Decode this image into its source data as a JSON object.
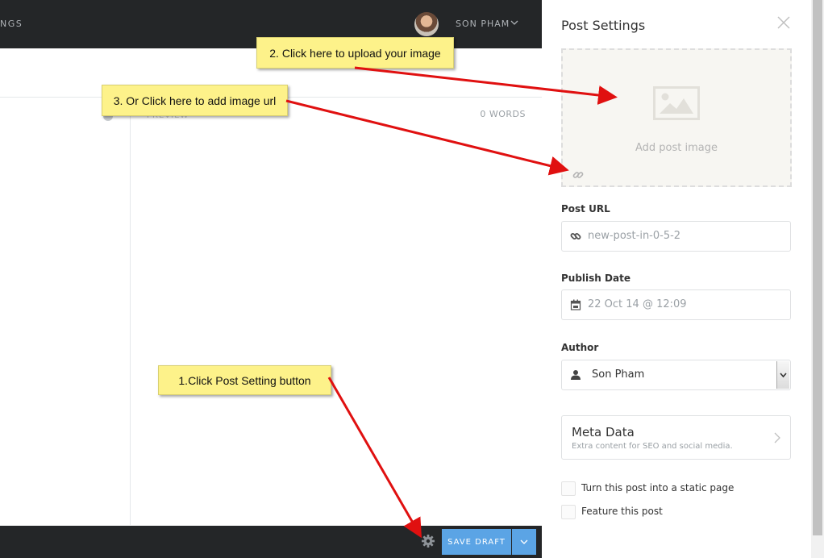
{
  "header": {
    "nav_fragment": "NGS",
    "user_name": "SON PHAM"
  },
  "editor": {
    "preview_label": "PREVIEW",
    "word_count": "0 WORDS"
  },
  "footer": {
    "save_label": "SAVE DRAFT"
  },
  "post_settings": {
    "title": "Post Settings",
    "image_label": "Add post image",
    "post_url_label": "Post URL",
    "post_url_value": "new-post-in-0-5-2",
    "publish_date_label": "Publish Date",
    "publish_date_value": "22 Oct 14 @ 12:09",
    "author_label": "Author",
    "author_value": "Son Pham",
    "meta_title": "Meta Data",
    "meta_subtitle": "Extra content for SEO and social media.",
    "static_page_label": "Turn this post into a static page",
    "feature_label": "Feature this post"
  },
  "annotations": {
    "upload": "2. Click here to upload your image",
    "url": "3. Or Click here to add image url",
    "settings": "1.Click Post Setting button"
  },
  "colors": {
    "dark_bar": "#242628",
    "accent": "#5ba4e5",
    "callout": "#fdf28a",
    "arrow": "#e01010"
  }
}
